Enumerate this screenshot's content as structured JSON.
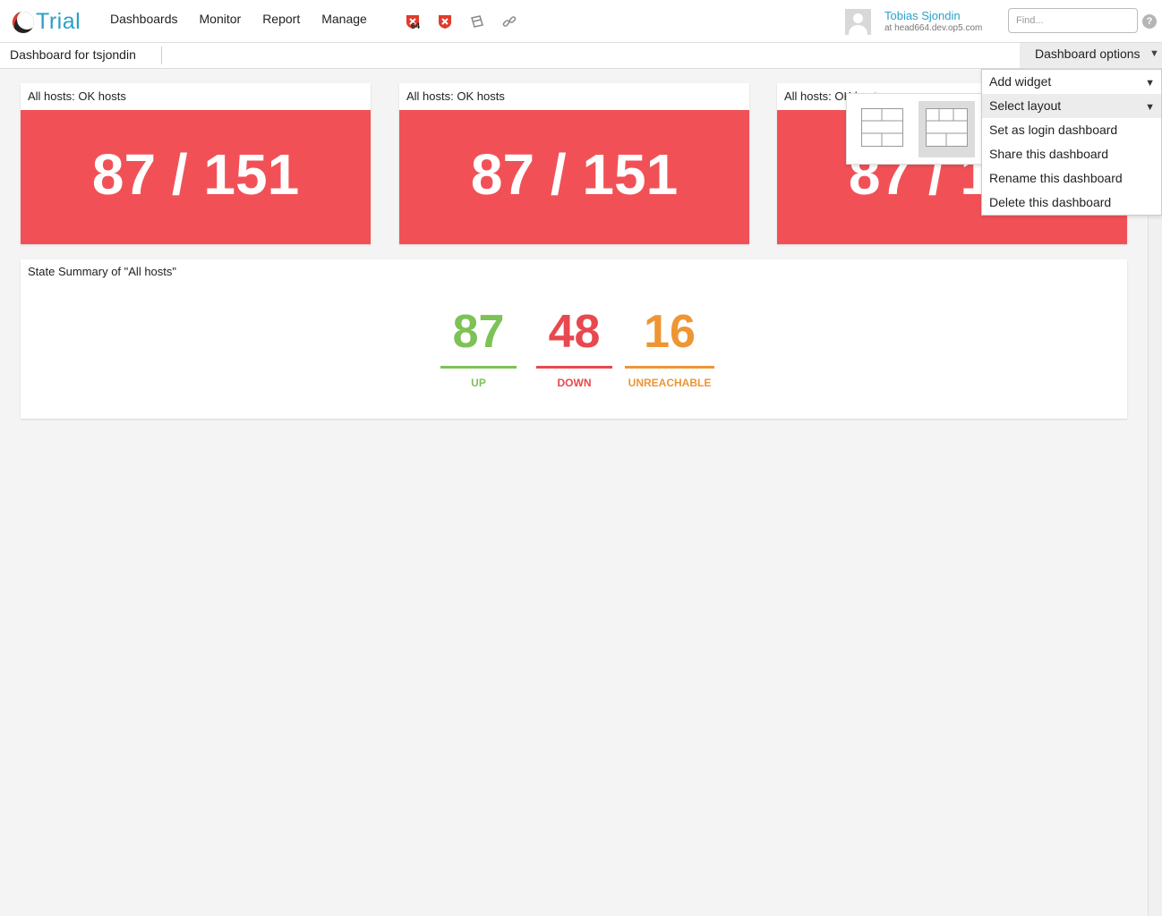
{
  "app": {
    "logo_text": "Trial",
    "brand_color": "#2aa0c9"
  },
  "nav": {
    "items": [
      "Dashboards",
      "Monitor",
      "Report",
      "Manage"
    ]
  },
  "tools": [
    {
      "icon": "host-problems-icon",
      "badge": "64"
    },
    {
      "icon": "service-problems-icon"
    },
    {
      "icon": "notification-icon"
    },
    {
      "icon": "link-icon"
    }
  ],
  "user": {
    "name": "Tobias Sjondin",
    "host": "at head664.dev.op5.com"
  },
  "search": {
    "placeholder": "Find..."
  },
  "help": {
    "label": "?"
  },
  "subbar": {
    "title": "Dashboard for tsjondin",
    "options_label": "Dashboard options"
  },
  "widgets": [
    {
      "title": "All hosts: OK hosts",
      "value": "87 / 151",
      "color": "#f15156"
    },
    {
      "title": "All hosts: OK hosts",
      "value": "87 / 151",
      "color": "#f15156"
    },
    {
      "title": "All hosts: OK hosts",
      "value": "87 / 151",
      "color": "#f15156"
    }
  ],
  "summary": {
    "title": "State Summary of \"All hosts\"",
    "stats": [
      {
        "value": "87",
        "label": "UP",
        "color": "#7cc256"
      },
      {
        "value": "48",
        "label": "DOWN",
        "color": "#e8484f"
      },
      {
        "value": "16",
        "label": "UNREACHABLE",
        "color": "#ee9534"
      }
    ]
  },
  "menu": {
    "items": [
      {
        "label": "Add widget",
        "has_submenu": true
      },
      {
        "label": "Select layout",
        "has_submenu": true,
        "active": true
      },
      {
        "label": "Set as login dashboard"
      },
      {
        "label": "Share this dashboard"
      },
      {
        "label": "Rename this dashboard"
      },
      {
        "label": "Delete this dashboard"
      }
    ],
    "caret": "▼"
  },
  "layouts": [
    {
      "name": "layout-2-column",
      "selected": false
    },
    {
      "name": "layout-3-column",
      "selected": true
    }
  ]
}
